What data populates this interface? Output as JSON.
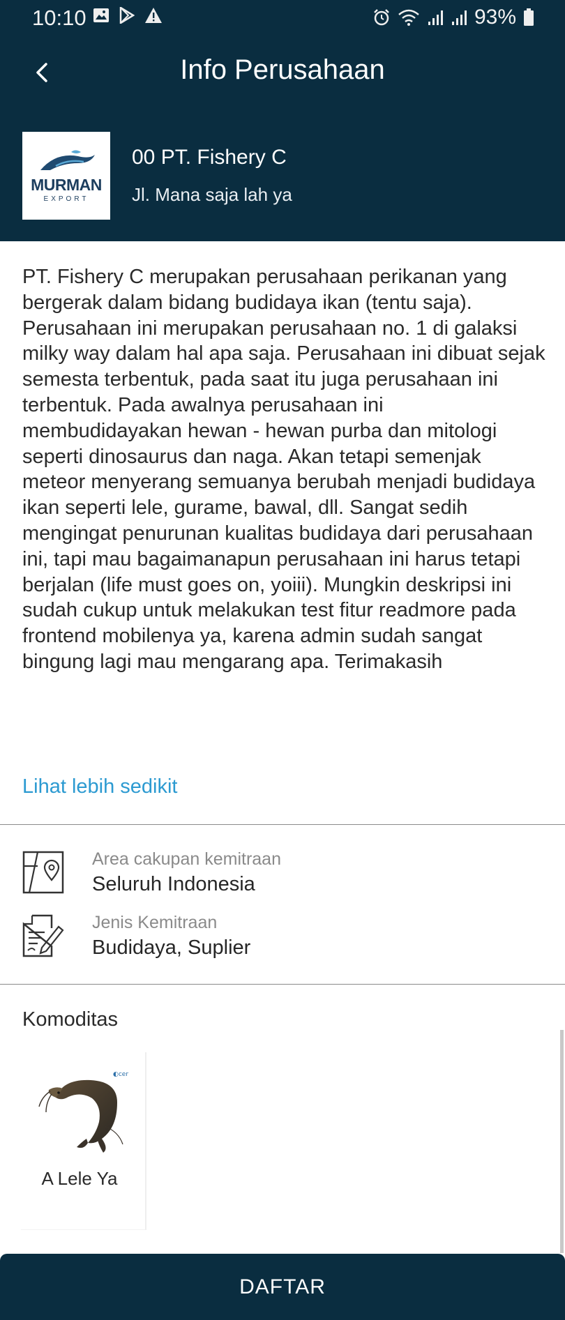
{
  "status_bar": {
    "time": "10:10",
    "battery_percent": "93%",
    "icons_left": [
      "image-icon",
      "play-store-icon",
      "warning-icon"
    ],
    "icons_right": [
      "alarm-icon",
      "wifi-icon",
      "signal-icon",
      "signal-icon",
      "battery-icon"
    ]
  },
  "app_bar": {
    "title": "Info Perusahaan",
    "back_icon": "chevron-left-icon"
  },
  "company": {
    "name": "00 PT. Fishery C",
    "address": "Jl. Mana saja lah ya",
    "logo_text": "MURMAN",
    "logo_subtext": "EXPORT"
  },
  "description": {
    "text": "PT. Fishery C merupakan perusahaan perikanan yang bergerak dalam bidang budidaya ikan (tentu saja). Perusahaan ini merupakan perusahaan no. 1 di galaksi milky way dalam hal apa saja. Perusahaan ini dibuat sejak semesta terbentuk, pada saat itu juga perusahaan ini terbentuk. Pada awalnya perusahaan ini membudidayakan hewan - hewan purba dan mitologi seperti dinosaurus dan naga. Akan tetapi semenjak meteor menyerang semuanya berubah menjadi budidaya ikan seperti lele, gurame, bawal, dll. Sangat sedih mengingat penurunan kualitas budidaya dari perusahaan ini, tapi mau bagaimanapun perusahaan ini harus tetapi berjalan (life must goes on, yoiii). Mungkin deskripsi ini sudah cukup untuk melakukan test fitur readmore pada frontend mobilenya ya, karena admin sudah sangat bingung lagi mau mengarang apa. Terimakasih",
    "toggle_label": "Lihat lebih sedikit"
  },
  "info": {
    "area": {
      "label": "Area cakupan kemitraan",
      "value": "Seluruh Indonesia",
      "icon": "map-pin-icon"
    },
    "type": {
      "label": "Jenis Kemitraan",
      "value": "Budidaya, Suplier",
      "icon": "document-edit-icon"
    }
  },
  "commodities": {
    "title": "Komoditas",
    "items": [
      {
        "name": "A Lele Ya",
        "image": "catfish-image"
      }
    ]
  },
  "footer": {
    "button_label": "DAFTAR"
  },
  "colors": {
    "primary_dark": "#0a2d40",
    "link": "#2c9ad1",
    "muted_text": "#8a8a8a"
  }
}
